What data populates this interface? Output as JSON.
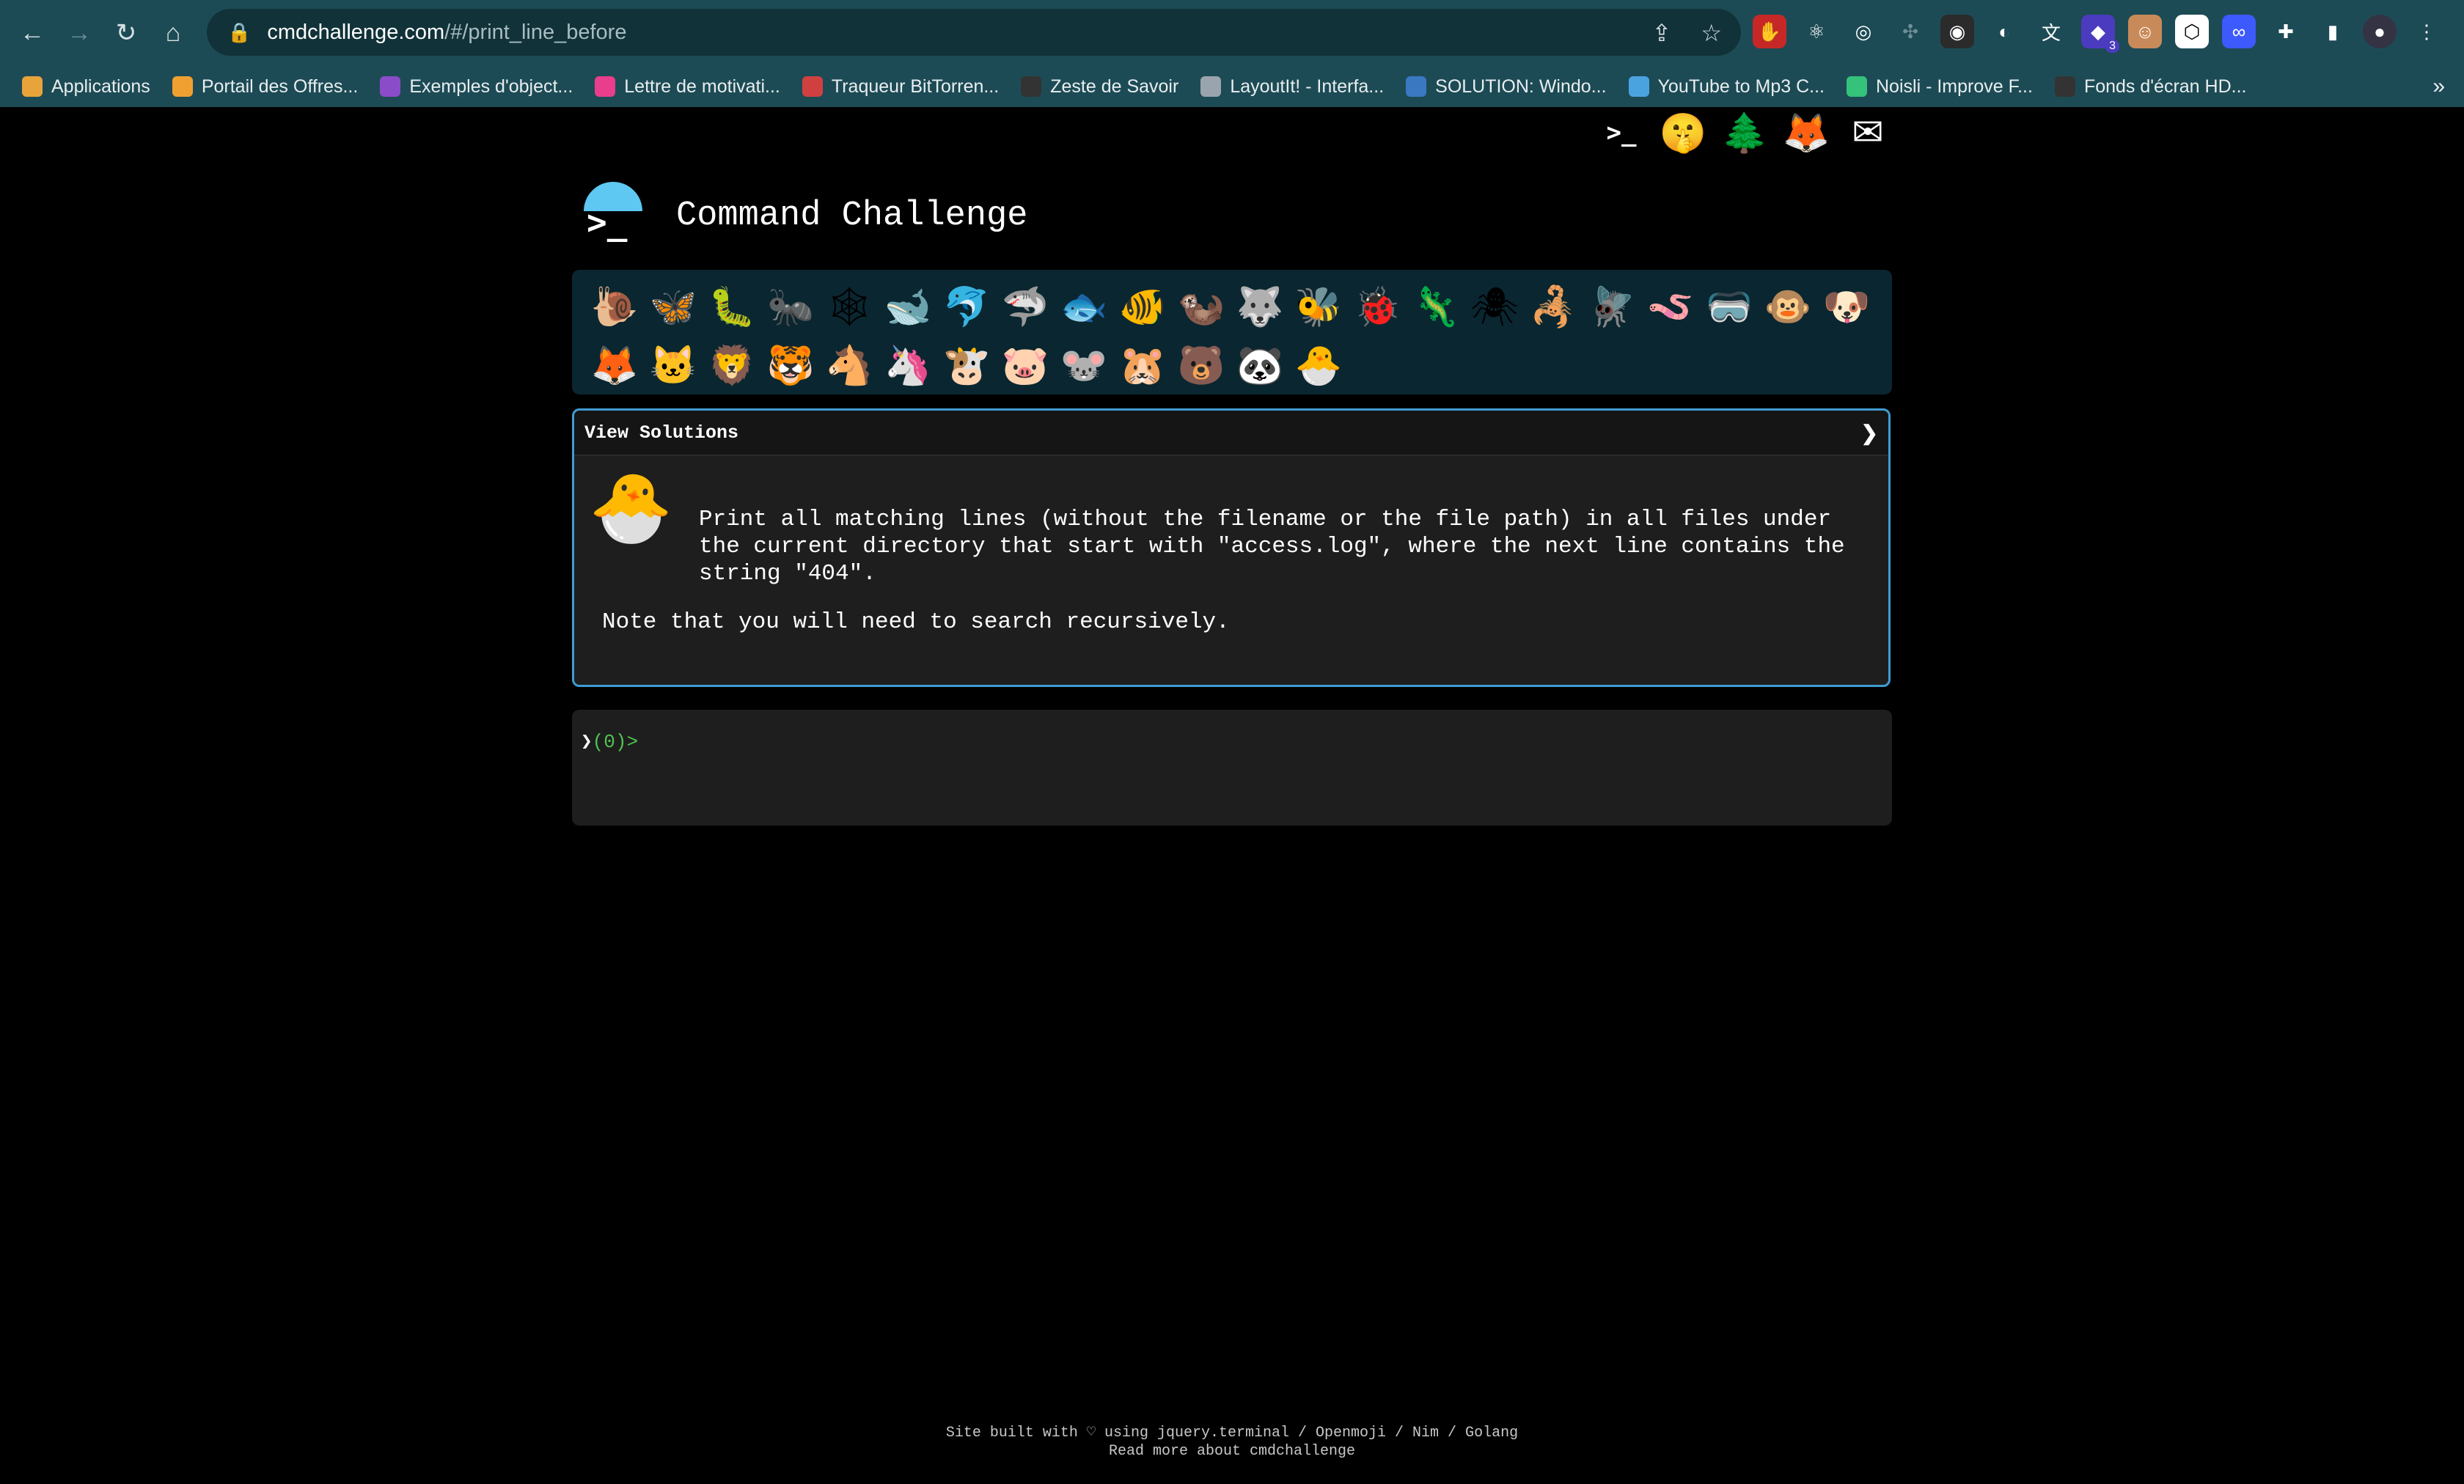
{
  "browser": {
    "url_host": "cmdchallenge.com",
    "url_path": "/#/print_line_before",
    "extension_badge": "3"
  },
  "bookmarks": [
    {
      "label": "Applications",
      "color": "#e8a33a"
    },
    {
      "label": "Portail des Offres...",
      "color": "#f0a030"
    },
    {
      "label": "Exemples d'object...",
      "color": "#8a4cc9"
    },
    {
      "label": "Lettre de motivati...",
      "color": "#e83e8c"
    },
    {
      "label": "Traqueur BitTorren...",
      "color": "#d04040"
    },
    {
      "label": "Zeste de Savoir",
      "color": "#333333"
    },
    {
      "label": "LayoutIt! - Interfa...",
      "color": "#9aa4ae"
    },
    {
      "label": "SOLUTION: Windo...",
      "color": "#3a78c2"
    },
    {
      "label": "YouTube to Mp3 C...",
      "color": "#4aa3df"
    },
    {
      "label": "Noisli - Improve F...",
      "color": "#35c27a"
    },
    {
      "label": "Fonds d'écran HD...",
      "color": "#333333"
    }
  ],
  "header": {
    "logo_symbol": ">_",
    "title": "Command Challenge",
    "top_icons": [
      {
        "name": "terminal-icon",
        "glyph": ">_"
      },
      {
        "name": "shush-face-icon",
        "glyph": "🤫"
      },
      {
        "name": "tree-icon",
        "glyph": "🌲"
      },
      {
        "name": "gitlab-icon",
        "glyph": "🦊"
      },
      {
        "name": "mail-icon",
        "glyph": "✉"
      }
    ]
  },
  "levels": [
    {
      "name": "snail",
      "glyph": "🐌"
    },
    {
      "name": "butterfly",
      "glyph": "🦋"
    },
    {
      "name": "caterpillar",
      "glyph": "🐛"
    },
    {
      "name": "ant",
      "glyph": "🐜"
    },
    {
      "name": "web",
      "glyph": "🕸"
    },
    {
      "name": "whale",
      "glyph": "🐋"
    },
    {
      "name": "dolphin",
      "glyph": "🐬"
    },
    {
      "name": "shark",
      "glyph": "🦈"
    },
    {
      "name": "fish",
      "glyph": "🐟"
    },
    {
      "name": "tropical-fish",
      "glyph": "🐠"
    },
    {
      "name": "otter",
      "glyph": "🦦"
    },
    {
      "name": "wolf",
      "glyph": "🐺"
    },
    {
      "name": "bee",
      "glyph": "🐝"
    },
    {
      "name": "ladybug",
      "glyph": "🐞"
    },
    {
      "name": "lizard",
      "glyph": "🦎"
    },
    {
      "name": "spider",
      "glyph": "🕷"
    },
    {
      "name": "scorpion",
      "glyph": "🦂"
    },
    {
      "name": "fly",
      "glyph": "🪰"
    },
    {
      "name": "worm",
      "glyph": "🪱"
    },
    {
      "name": "mask",
      "glyph": "🥽"
    },
    {
      "name": "monkey",
      "glyph": "🐵"
    },
    {
      "name": "dog",
      "glyph": "🐶"
    },
    {
      "name": "fox",
      "glyph": "🦊"
    },
    {
      "name": "cat",
      "glyph": "🐱"
    },
    {
      "name": "lion",
      "glyph": "🦁"
    },
    {
      "name": "tiger",
      "glyph": "🐯"
    },
    {
      "name": "horse",
      "glyph": "🐴"
    },
    {
      "name": "unicorn",
      "glyph": "🦄"
    },
    {
      "name": "cow",
      "glyph": "🐮"
    },
    {
      "name": "pig",
      "glyph": "🐷"
    },
    {
      "name": "mouse",
      "glyph": "🐭"
    },
    {
      "name": "hamster",
      "glyph": "🐹"
    },
    {
      "name": "bear",
      "glyph": "🐻"
    },
    {
      "name": "panda",
      "glyph": "🐼"
    },
    {
      "name": "hatching-chick",
      "glyph": "🐣"
    }
  ],
  "panel": {
    "header_label": "View Solutions",
    "chevron": "❯",
    "chick_glyph": "🐣",
    "task_lines": [
      "Print all matching lines (without the filename or the file path) in all files under",
      "the current directory that start with \"access.log\", where the next line contains the",
      "string \"404\"."
    ],
    "note": "Note that you will need to search recursively."
  },
  "terminal": {
    "cursor": "❯",
    "prompt": "(0)>"
  },
  "footer": {
    "line1": "Site built with ♡ using jquery.terminal / Openmoji / Nim / Golang",
    "line2": "Read more about cmdchallenge"
  }
}
